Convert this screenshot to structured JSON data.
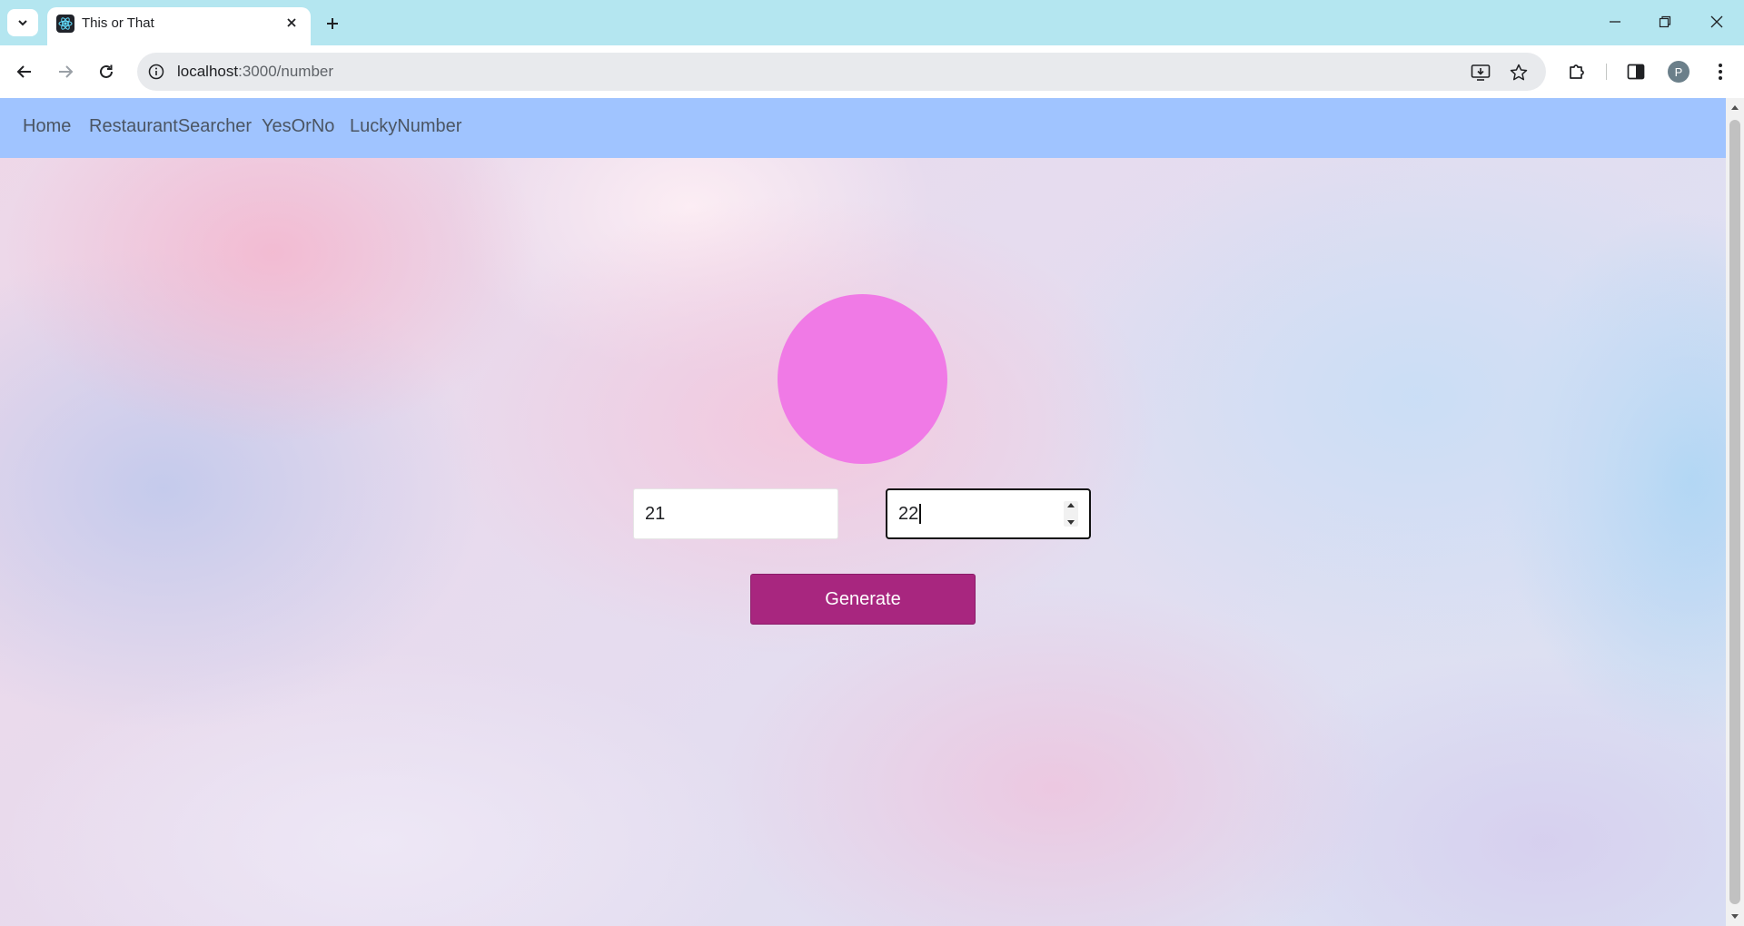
{
  "browser": {
    "tab_title": "This or That",
    "url_host": "localhost",
    "url_path": ":3000/number",
    "profile_initial": "P"
  },
  "nav": {
    "links": [
      "Home",
      "RestaurantSearcher",
      "YesOrNo",
      "LuckyNumber"
    ]
  },
  "generator": {
    "min_value": "21",
    "max_value": "22",
    "button_label": "Generate"
  },
  "colors": {
    "navbar": "#a0c4ff",
    "circle": "#f07ae6",
    "button": "#a8267f",
    "tabstrip": "#b4e6f0"
  },
  "icons": {
    "tab_search": "chevron-down-icon",
    "favicon": "react-logo-icon",
    "tab_close": "close-icon",
    "new_tab": "plus-icon",
    "back": "arrow-left-icon",
    "forward": "arrow-right-icon",
    "reload": "reload-icon",
    "site_info": "info-icon",
    "install": "install-app-icon",
    "bookmark": "star-icon",
    "extensions": "puzzle-icon",
    "side_panel": "side-panel-icon",
    "menu": "kebab-menu-icon"
  }
}
